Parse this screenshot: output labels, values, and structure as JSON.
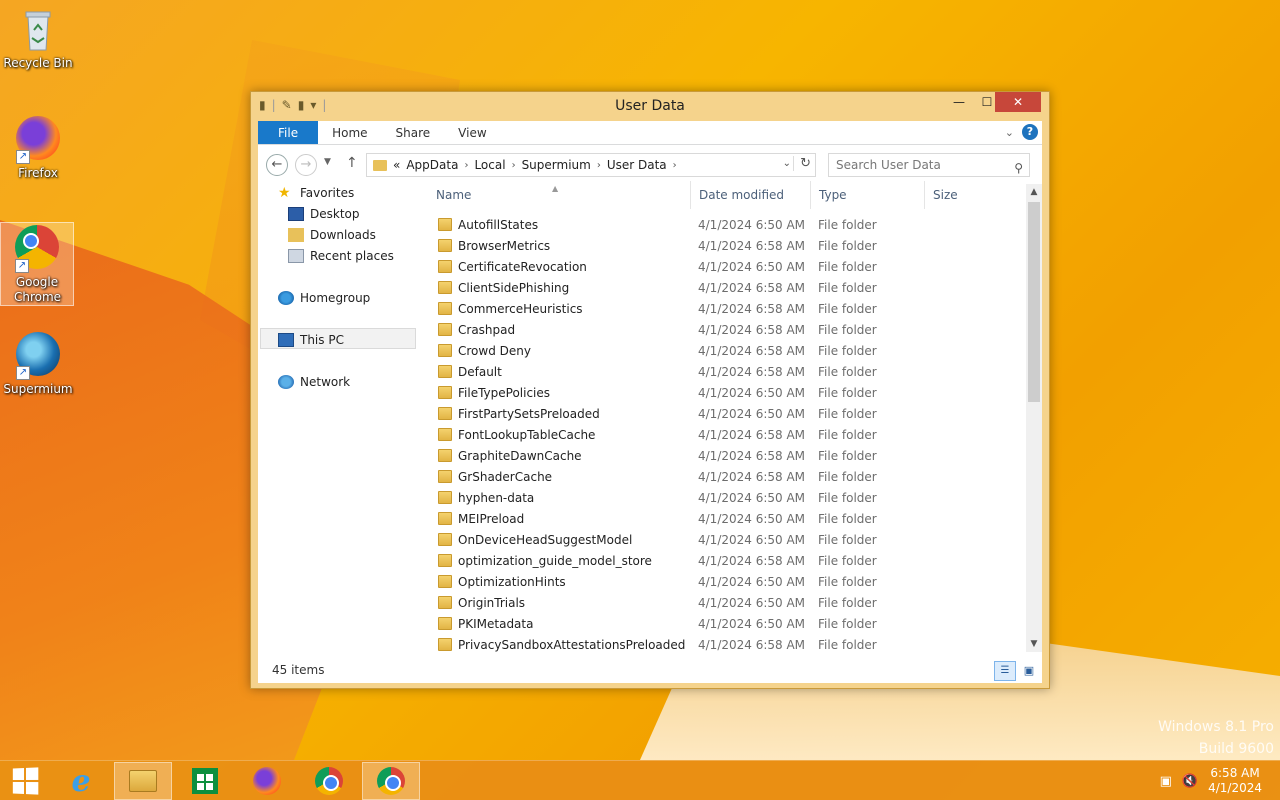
{
  "desktop": {
    "icons": [
      {
        "label": "Recycle Bin"
      },
      {
        "label": "Firefox"
      },
      {
        "label": "Google Chrome"
      },
      {
        "label": "Supermium"
      }
    ],
    "watermark_line1": "Windows 8.1 Pro",
    "watermark_line2": "Build 9600"
  },
  "window": {
    "title": "User Data",
    "ribbon_tabs": [
      "File",
      "Home",
      "Share",
      "View"
    ],
    "address": {
      "overflow": "«",
      "crumbs": [
        "AppData",
        "Local",
        "Supermium",
        "User Data"
      ]
    },
    "search_placeholder": "Search User Data",
    "nav": {
      "favorites": "Favorites",
      "desktop": "Desktop",
      "downloads": "Downloads",
      "recent": "Recent places",
      "homegroup": "Homegroup",
      "thispc": "This PC",
      "network": "Network"
    },
    "columns": [
      "Name",
      "Date modified",
      "Type",
      "Size"
    ],
    "files": [
      {
        "name": "AutofillStates",
        "date": "4/1/2024 6:50 AM",
        "type": "File folder"
      },
      {
        "name": "BrowserMetrics",
        "date": "4/1/2024 6:58 AM",
        "type": "File folder"
      },
      {
        "name": "CertificateRevocation",
        "date": "4/1/2024 6:50 AM",
        "type": "File folder"
      },
      {
        "name": "ClientSidePhishing",
        "date": "4/1/2024 6:58 AM",
        "type": "File folder"
      },
      {
        "name": "CommerceHeuristics",
        "date": "4/1/2024 6:58 AM",
        "type": "File folder"
      },
      {
        "name": "Crashpad",
        "date": "4/1/2024 6:58 AM",
        "type": "File folder"
      },
      {
        "name": "Crowd Deny",
        "date": "4/1/2024 6:58 AM",
        "type": "File folder"
      },
      {
        "name": "Default",
        "date": "4/1/2024 6:58 AM",
        "type": "File folder"
      },
      {
        "name": "FileTypePolicies",
        "date": "4/1/2024 6:50 AM",
        "type": "File folder"
      },
      {
        "name": "FirstPartySetsPreloaded",
        "date": "4/1/2024 6:50 AM",
        "type": "File folder"
      },
      {
        "name": "FontLookupTableCache",
        "date": "4/1/2024 6:58 AM",
        "type": "File folder"
      },
      {
        "name": "GraphiteDawnCache",
        "date": "4/1/2024 6:58 AM",
        "type": "File folder"
      },
      {
        "name": "GrShaderCache",
        "date": "4/1/2024 6:58 AM",
        "type": "File folder"
      },
      {
        "name": "hyphen-data",
        "date": "4/1/2024 6:50 AM",
        "type": "File folder"
      },
      {
        "name": "MEIPreload",
        "date": "4/1/2024 6:50 AM",
        "type": "File folder"
      },
      {
        "name": "OnDeviceHeadSuggestModel",
        "date": "4/1/2024 6:50 AM",
        "type": "File folder"
      },
      {
        "name": "optimization_guide_model_store",
        "date": "4/1/2024 6:58 AM",
        "type": "File folder"
      },
      {
        "name": "OptimizationHints",
        "date": "4/1/2024 6:50 AM",
        "type": "File folder"
      },
      {
        "name": "OriginTrials",
        "date": "4/1/2024 6:50 AM",
        "type": "File folder"
      },
      {
        "name": "PKIMetadata",
        "date": "4/1/2024 6:50 AM",
        "type": "File folder"
      },
      {
        "name": "PrivacySandboxAttestationsPreloaded",
        "date": "4/1/2024 6:58 AM",
        "type": "File folder"
      }
    ],
    "status": "45 items"
  },
  "taskbar": {
    "time": "6:58 AM",
    "date": "4/1/2024"
  },
  "colors": {
    "accent": "#1979ca",
    "taskbar": "#e88c16",
    "close": "#c7473a"
  }
}
